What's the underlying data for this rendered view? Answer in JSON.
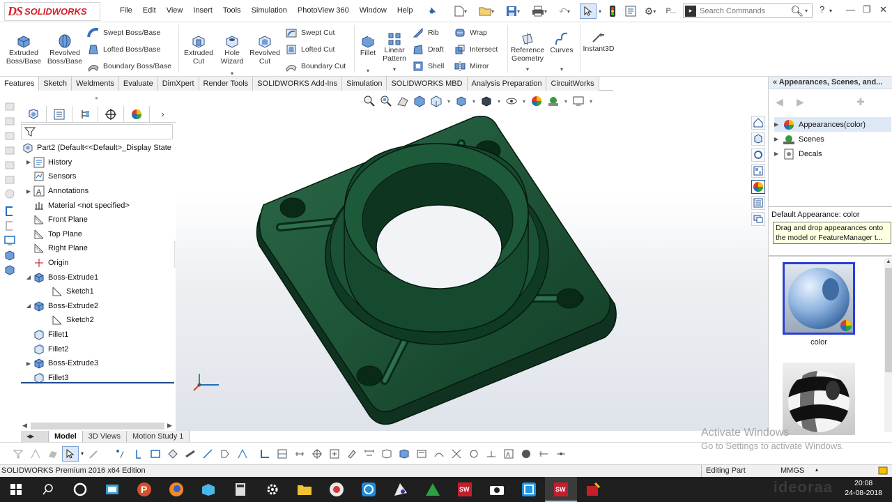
{
  "app": {
    "brand_prefix": "DS",
    "brand_name": "SOLIDWORKS"
  },
  "menu": [
    "File",
    "Edit",
    "View",
    "Insert",
    "Tools",
    "Simulation",
    "PhotoView 360",
    "Window",
    "Help"
  ],
  "quick_access_overflow": "P...",
  "search": {
    "placeholder": "Search Commands"
  },
  "command_manager": {
    "extruded_boss": "Extruded Boss/Base",
    "revolved_boss": "Revolved Boss/Base",
    "swept_boss": "Swept Boss/Base",
    "lofted_boss": "Lofted Boss/Base",
    "boundary_boss": "Boundary Boss/Base",
    "extruded_cut": "Extruded Cut",
    "hole_wizard": "Hole Wizard",
    "revolved_cut": "Revolved Cut",
    "swept_cut": "Swept Cut",
    "lofted_cut": "Lofted Cut",
    "boundary_cut": "Boundary Cut",
    "fillet": "Fillet",
    "linear_pattern": "Linear Pattern",
    "rib": "Rib",
    "draft": "Draft",
    "shell": "Shell",
    "wrap": "Wrap",
    "intersect": "Intersect",
    "mirror": "Mirror",
    "reference_geometry": "Reference Geometry",
    "curves": "Curves",
    "instant3d": "Instant3D"
  },
  "tabs": [
    "Features",
    "Sketch",
    "Weldments",
    "Evaluate",
    "DimXpert",
    "Render Tools",
    "SOLIDWORKS Add-Ins",
    "Simulation",
    "SOLIDWORKS MBD",
    "Analysis Preparation",
    "CircuitWorks"
  ],
  "feature_tree": {
    "root": "Part2  (Default<<Default>_Display State",
    "nodes": [
      {
        "label": "History",
        "expandable": true
      },
      {
        "label": "Sensors",
        "expandable": false
      },
      {
        "label": "Annotations",
        "expandable": true
      },
      {
        "label": "Material <not specified>",
        "expandable": false
      },
      {
        "label": "Front Plane",
        "expandable": false
      },
      {
        "label": "Top Plane",
        "expandable": false
      },
      {
        "label": "Right Plane",
        "expandable": false
      },
      {
        "label": "Origin",
        "expandable": false
      },
      {
        "label": "Boss-Extrude1",
        "expandable": true,
        "expanded": true
      },
      {
        "label": "Sketch1",
        "expandable": false,
        "child": true
      },
      {
        "label": "Boss-Extrude2",
        "expandable": true,
        "expanded": true
      },
      {
        "label": "Sketch2",
        "expandable": false,
        "child": true
      },
      {
        "label": "Fillet1",
        "expandable": false
      },
      {
        "label": "Fillet2",
        "expandable": false
      },
      {
        "label": "Boss-Extrude3",
        "expandable": true
      },
      {
        "label": "Fillet3",
        "expandable": false
      }
    ]
  },
  "bottom_tabs": [
    "Model",
    "3D Views",
    "Motion Study 1"
  ],
  "task_pane": {
    "title": "Appearances, Scenes, and...",
    "tree": [
      "Appearances(color)",
      "Scenes",
      "Decals"
    ],
    "description": "Default Appearance: color",
    "note": "Drag and drop appearances onto the model or FeatureManager t...",
    "thumb_label": "color"
  },
  "watermark": {
    "line1": "Activate Windows",
    "line2": "Go to Settings to activate Windows."
  },
  "status": {
    "edition": "SOLIDWORKS Premium 2016 x64 Edition",
    "mode": "Editing Part",
    "units": "MMGS"
  },
  "clock": {
    "time": "20:08",
    "date": "24-08-2018"
  },
  "model_color": "#1d5236",
  "accent_color": "#1f4c8f"
}
